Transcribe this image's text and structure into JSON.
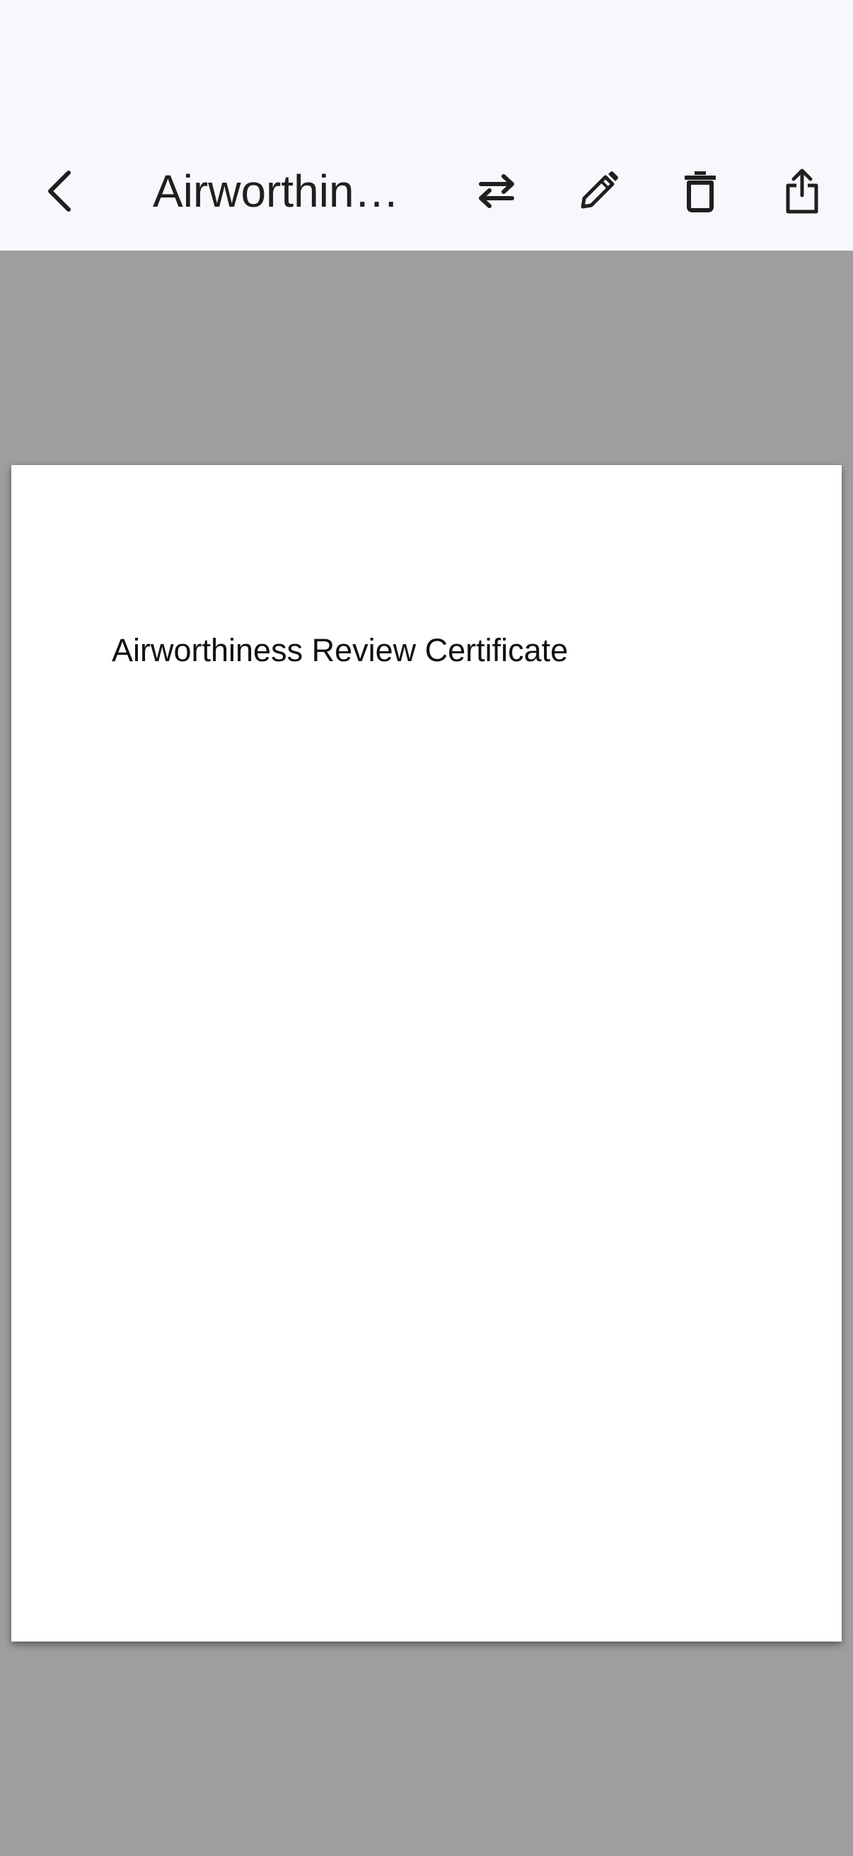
{
  "toolbar": {
    "title": "Airworthiness Review Certificate",
    "back_icon": "chevron-left-icon",
    "swap_icon": "swap-horizontal-icon",
    "edit_icon": "pencil-icon",
    "delete_icon": "trash-icon",
    "share_icon": "share-icon"
  },
  "document": {
    "heading": "Airworthiness Review Certificate"
  },
  "colors": {
    "toolbar_bg": "#f7f8fc",
    "viewer_bg": "#9e9e9e",
    "page_bg": "#ffffff",
    "icon": "#1f1f1f"
  }
}
